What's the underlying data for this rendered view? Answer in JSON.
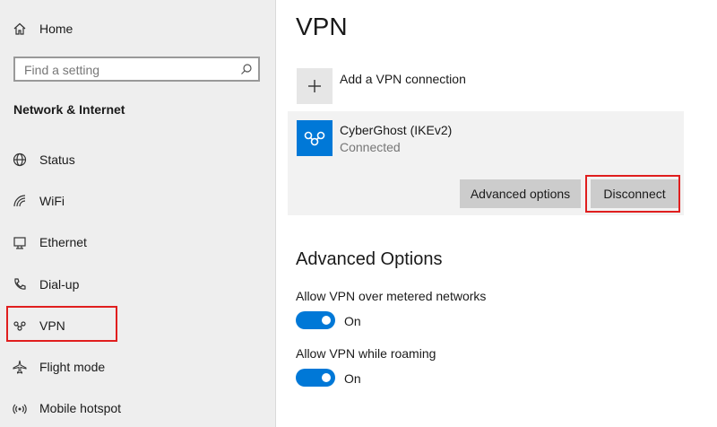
{
  "sidebar": {
    "home": {
      "label": "Home",
      "icon": "home-icon"
    },
    "search": {
      "placeholder": "Find a setting",
      "icon": "search-icon"
    },
    "section_title": "Network & Internet",
    "items": [
      {
        "label": "Status",
        "icon": "globe-icon"
      },
      {
        "label": "WiFi",
        "icon": "wifi-icon"
      },
      {
        "label": "Ethernet",
        "icon": "ethernet-icon"
      },
      {
        "label": "Dial-up",
        "icon": "phone-icon"
      },
      {
        "label": "VPN",
        "icon": "vpn-icon",
        "selected": true
      },
      {
        "label": "Flight mode",
        "icon": "airplane-icon"
      },
      {
        "label": "Mobile hotspot",
        "icon": "hotspot-icon"
      }
    ]
  },
  "main": {
    "title": "VPN",
    "add_connection_label": "Add a VPN connection",
    "connection": {
      "name": "CyberGhost (IKEv2)",
      "status": "Connected",
      "advanced_button": "Advanced options",
      "disconnect_button": "Disconnect"
    },
    "advanced_heading": "Advanced Options",
    "options": [
      {
        "label": "Allow VPN over metered networks",
        "state": "On",
        "enabled": true
      },
      {
        "label": "Allow VPN while roaming",
        "state": "On",
        "enabled": true
      }
    ]
  },
  "colors": {
    "accent": "#0078d7",
    "highlight": "#e01e1e",
    "sidebar_bg": "#eeeeee"
  }
}
